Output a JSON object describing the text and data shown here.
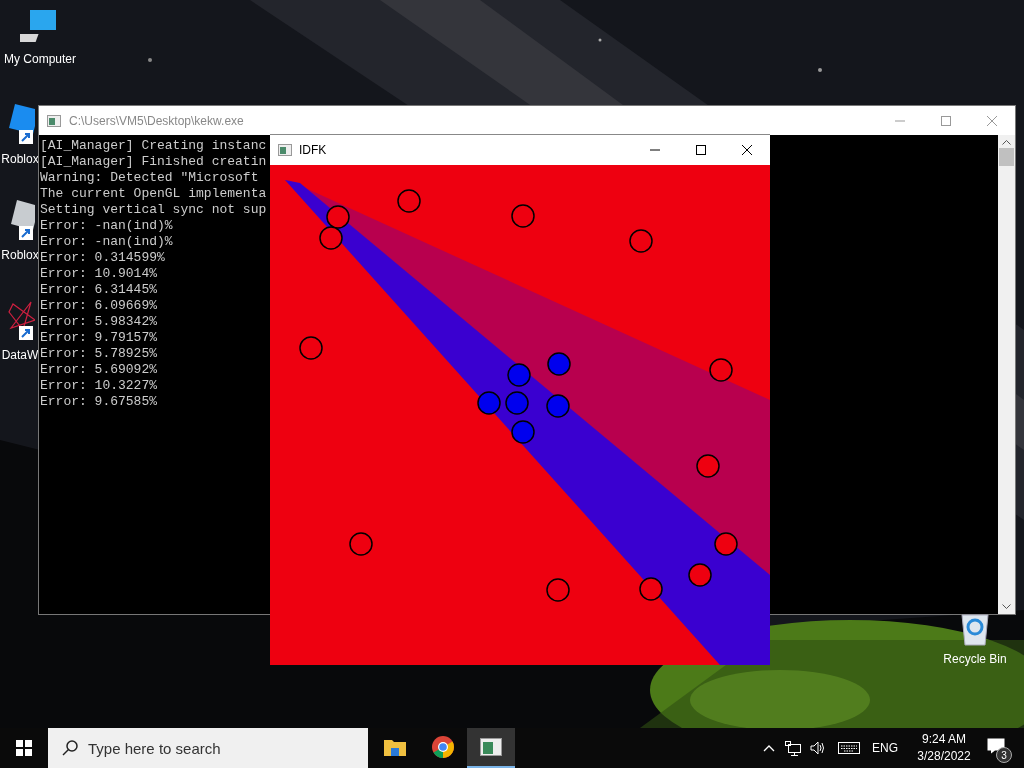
{
  "desktop_icons": [
    {
      "label": "My Computer",
      "kind": "computer"
    },
    {
      "label": "Roblox",
      "kind": "blue-tile"
    },
    {
      "label": "Roblox",
      "kind": "gray-tile"
    },
    {
      "label": "DataW",
      "kind": "network"
    }
  ],
  "recycle_bin": {
    "label": "Recycle Bin"
  },
  "console_window": {
    "title": "C:\\Users\\VM5\\Desktop\\kekw.exe",
    "lines": [
      "[AI_Manager] Creating instanc",
      "[AI_Manager] Finished creatin",
      "Warning: Detected \"Microsoft ",
      "The current OpenGL implementa",
      "Setting vertical sync not sup",
      "Error: -nan(ind)%",
      "Error: -nan(ind)%",
      "Error: 0.314599%",
      "Error: 10.9014%",
      "Error: 6.31445%",
      "Error: 6.09669%",
      "Error: 5.98342%",
      "Error: 9.79157%",
      "Error: 5.78925%",
      "Error: 5.69092%",
      "Error: 10.3227%",
      "Error: 9.67585%"
    ]
  },
  "plot_window": {
    "title": "IDFK",
    "points": [
      {
        "color": "#ee0010"
      },
      {
        "color": "#ee0010"
      },
      {
        "color": "#ee0010"
      },
      {
        "color": "#ee0010"
      },
      {
        "color": "#ee0010"
      },
      {
        "color": "#ee0010"
      },
      {
        "color": "#ee0010"
      },
      {
        "color": "#ee0010"
      },
      {
        "color": "#ee0010"
      },
      {
        "color": "#ee0010"
      },
      {
        "color": "#ee0010"
      },
      {
        "color": "#ee0010"
      },
      {
        "color": "#ee0010"
      },
      {
        "color": "#0000ee"
      },
      {
        "color": "#0000ee"
      },
      {
        "color": "#0000ee"
      },
      {
        "color": "#0000ee"
      },
      {
        "color": "#0000ee"
      },
      {
        "color": "#0000ee"
      }
    ]
  },
  "taskbar": {
    "search": {
      "placeholder": "Type here to search"
    },
    "apps": [
      {
        "kind": "explorer",
        "selected": false
      },
      {
        "kind": "chrome",
        "selected": false
      },
      {
        "kind": "console",
        "selected": true
      }
    ],
    "language": "ENG",
    "time": "9:24 AM",
    "date": "3/28/2022",
    "notifications": "3"
  }
}
